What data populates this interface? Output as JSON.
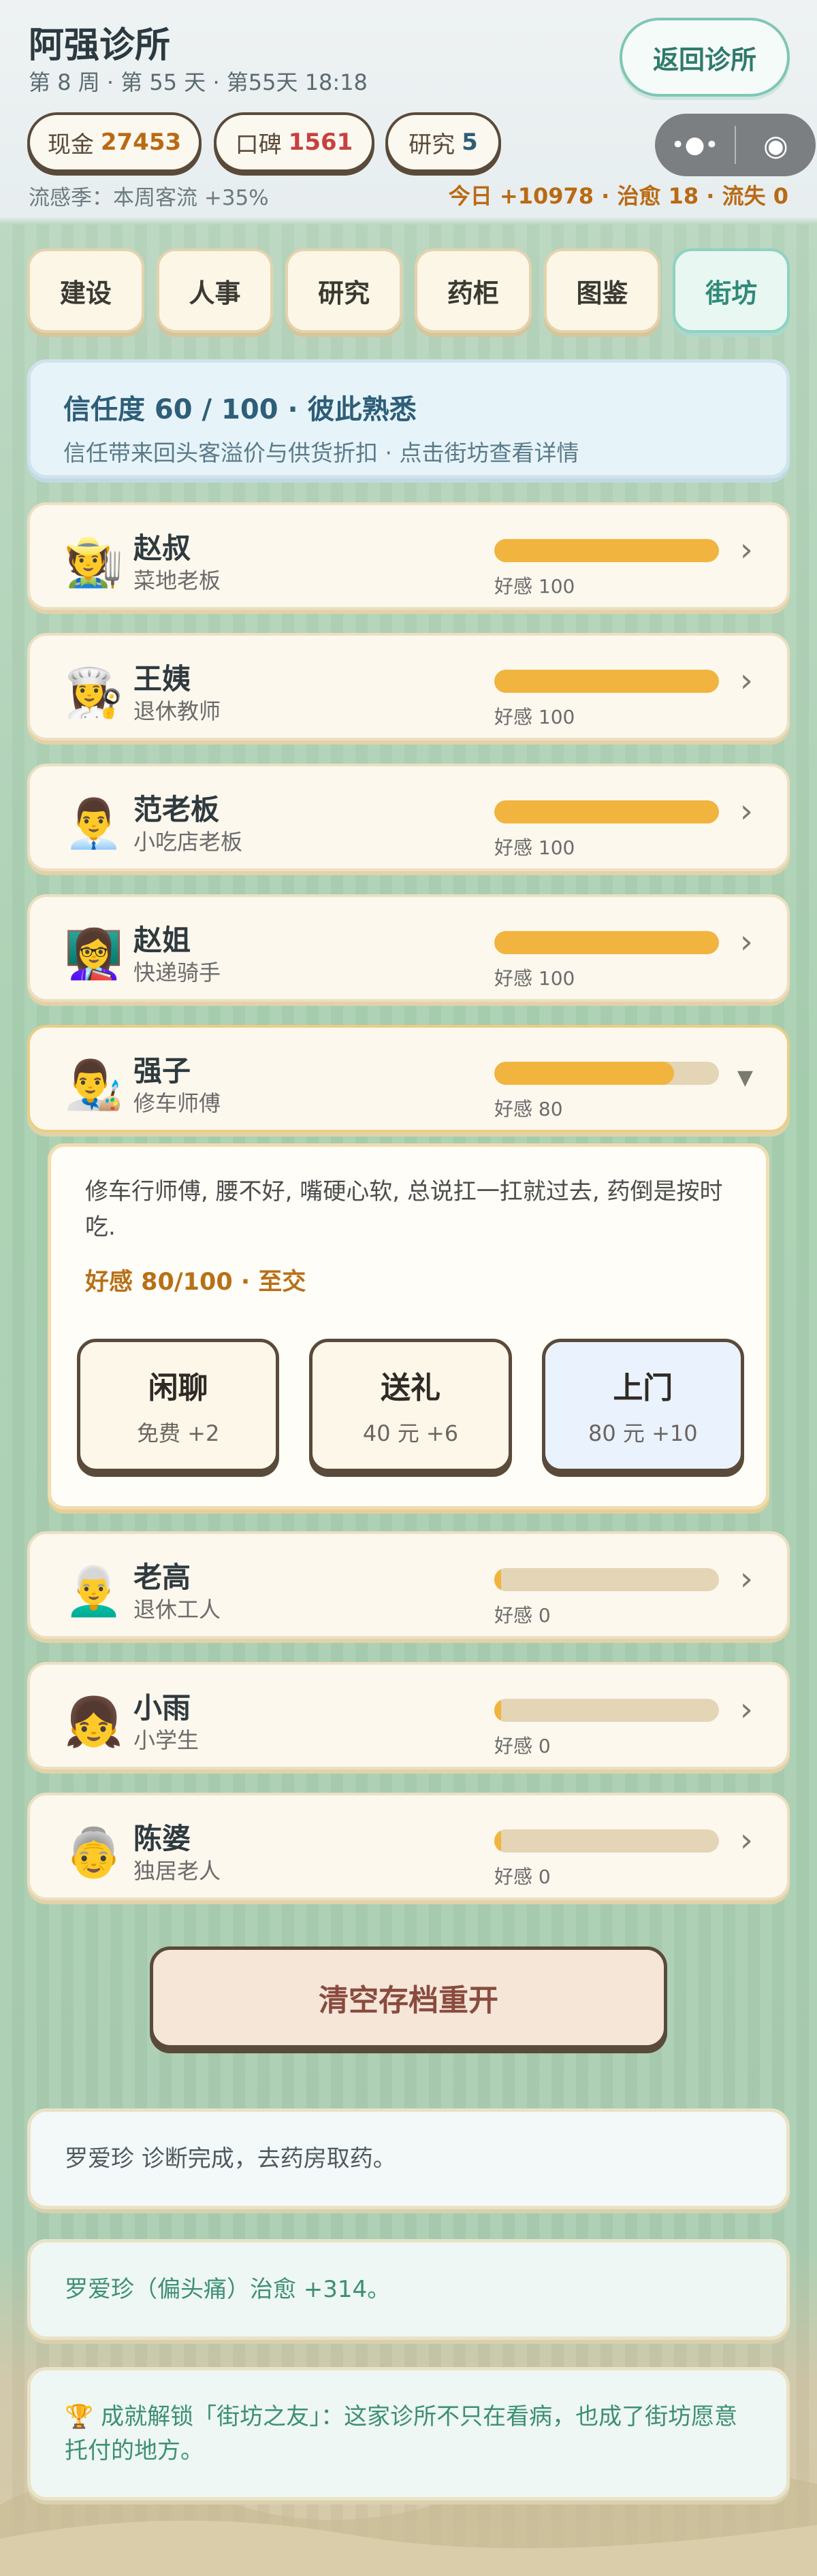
{
  "header": {
    "title": "阿强诊所",
    "subtitle": "第 8 周 · 第 55 天 · 第55天 18:18",
    "back_button": "返回诊所",
    "stats": [
      {
        "label": "现金",
        "value": "27453",
        "color": "#b96a14"
      },
      {
        "label": "口碑",
        "value": "1561",
        "color": "#c8413f"
      },
      {
        "label": "研究",
        "value": "5",
        "color": "#2e5e78"
      }
    ],
    "capsule": {
      "menu_glyph": "•●•",
      "target_glyph": "◉"
    },
    "status_left": "流感季：本周客流 +35%",
    "status_right": "今日 +10978 · 治愈 18 · 流失 0"
  },
  "tabs": [
    "建设",
    "人事",
    "研究",
    "药柜",
    "图鉴",
    "街坊"
  ],
  "active_tab": "街坊",
  "trust": {
    "title": "信任度 60 / 100 · 彼此熟悉",
    "subtitle": "信任带来回头客溢价与供货折扣 · 点击街坊查看详情"
  },
  "neighbors": [
    {
      "avatar": "🧑‍🌾",
      "name": "赵叔",
      "role": "菜地老板",
      "favor": 100,
      "favor_label": "好感 100"
    },
    {
      "avatar": "👩‍🍳",
      "name": "王姨",
      "role": "退休教师",
      "favor": 100,
      "favor_label": "好感 100"
    },
    {
      "avatar": "👨‍💼",
      "name": "范老板",
      "role": "小吃店老板",
      "favor": 100,
      "favor_label": "好感 100"
    },
    {
      "avatar": "👩‍🏫",
      "name": "赵姐",
      "role": "快递骑手",
      "favor": 100,
      "favor_label": "好感 100"
    },
    {
      "avatar": "👨‍🎨",
      "name": "强子",
      "role": "修车师傅",
      "favor": 80,
      "favor_label": "好感 80",
      "expanded": true
    },
    {
      "avatar": "👨‍🦳",
      "name": "老高",
      "role": "退休工人",
      "favor": 0,
      "favor_label": "好感 0"
    },
    {
      "avatar": "👧",
      "name": "小雨",
      "role": "小学生",
      "favor": 0,
      "favor_label": "好感 0"
    },
    {
      "avatar": "👵",
      "name": "陈婆",
      "role": "独居老人",
      "favor": 0,
      "favor_label": "好感 0"
    }
  ],
  "detail": {
    "description": "修车行师傅, 腰不好, 嘴硬心软, 总说扛一扛就过去, 药倒是按时吃.",
    "favor_text": "好感 80/100 · 至交",
    "actions": [
      {
        "title": "闲聊",
        "cost": "免费 +2"
      },
      {
        "title": "送礼",
        "cost": "40 元 +6"
      },
      {
        "title": "上门",
        "cost": "80 元 +10"
      }
    ]
  },
  "reset_button": "清空存档重开",
  "logs": [
    "罗爱珍 诊断完成，去药房取药。",
    "罗爱珍（偏头痛）治愈 +314。",
    "🏆 成就解锁「街坊之友」：这家诊所不只在看病，也成了街坊愿意托付的地方。"
  ]
}
